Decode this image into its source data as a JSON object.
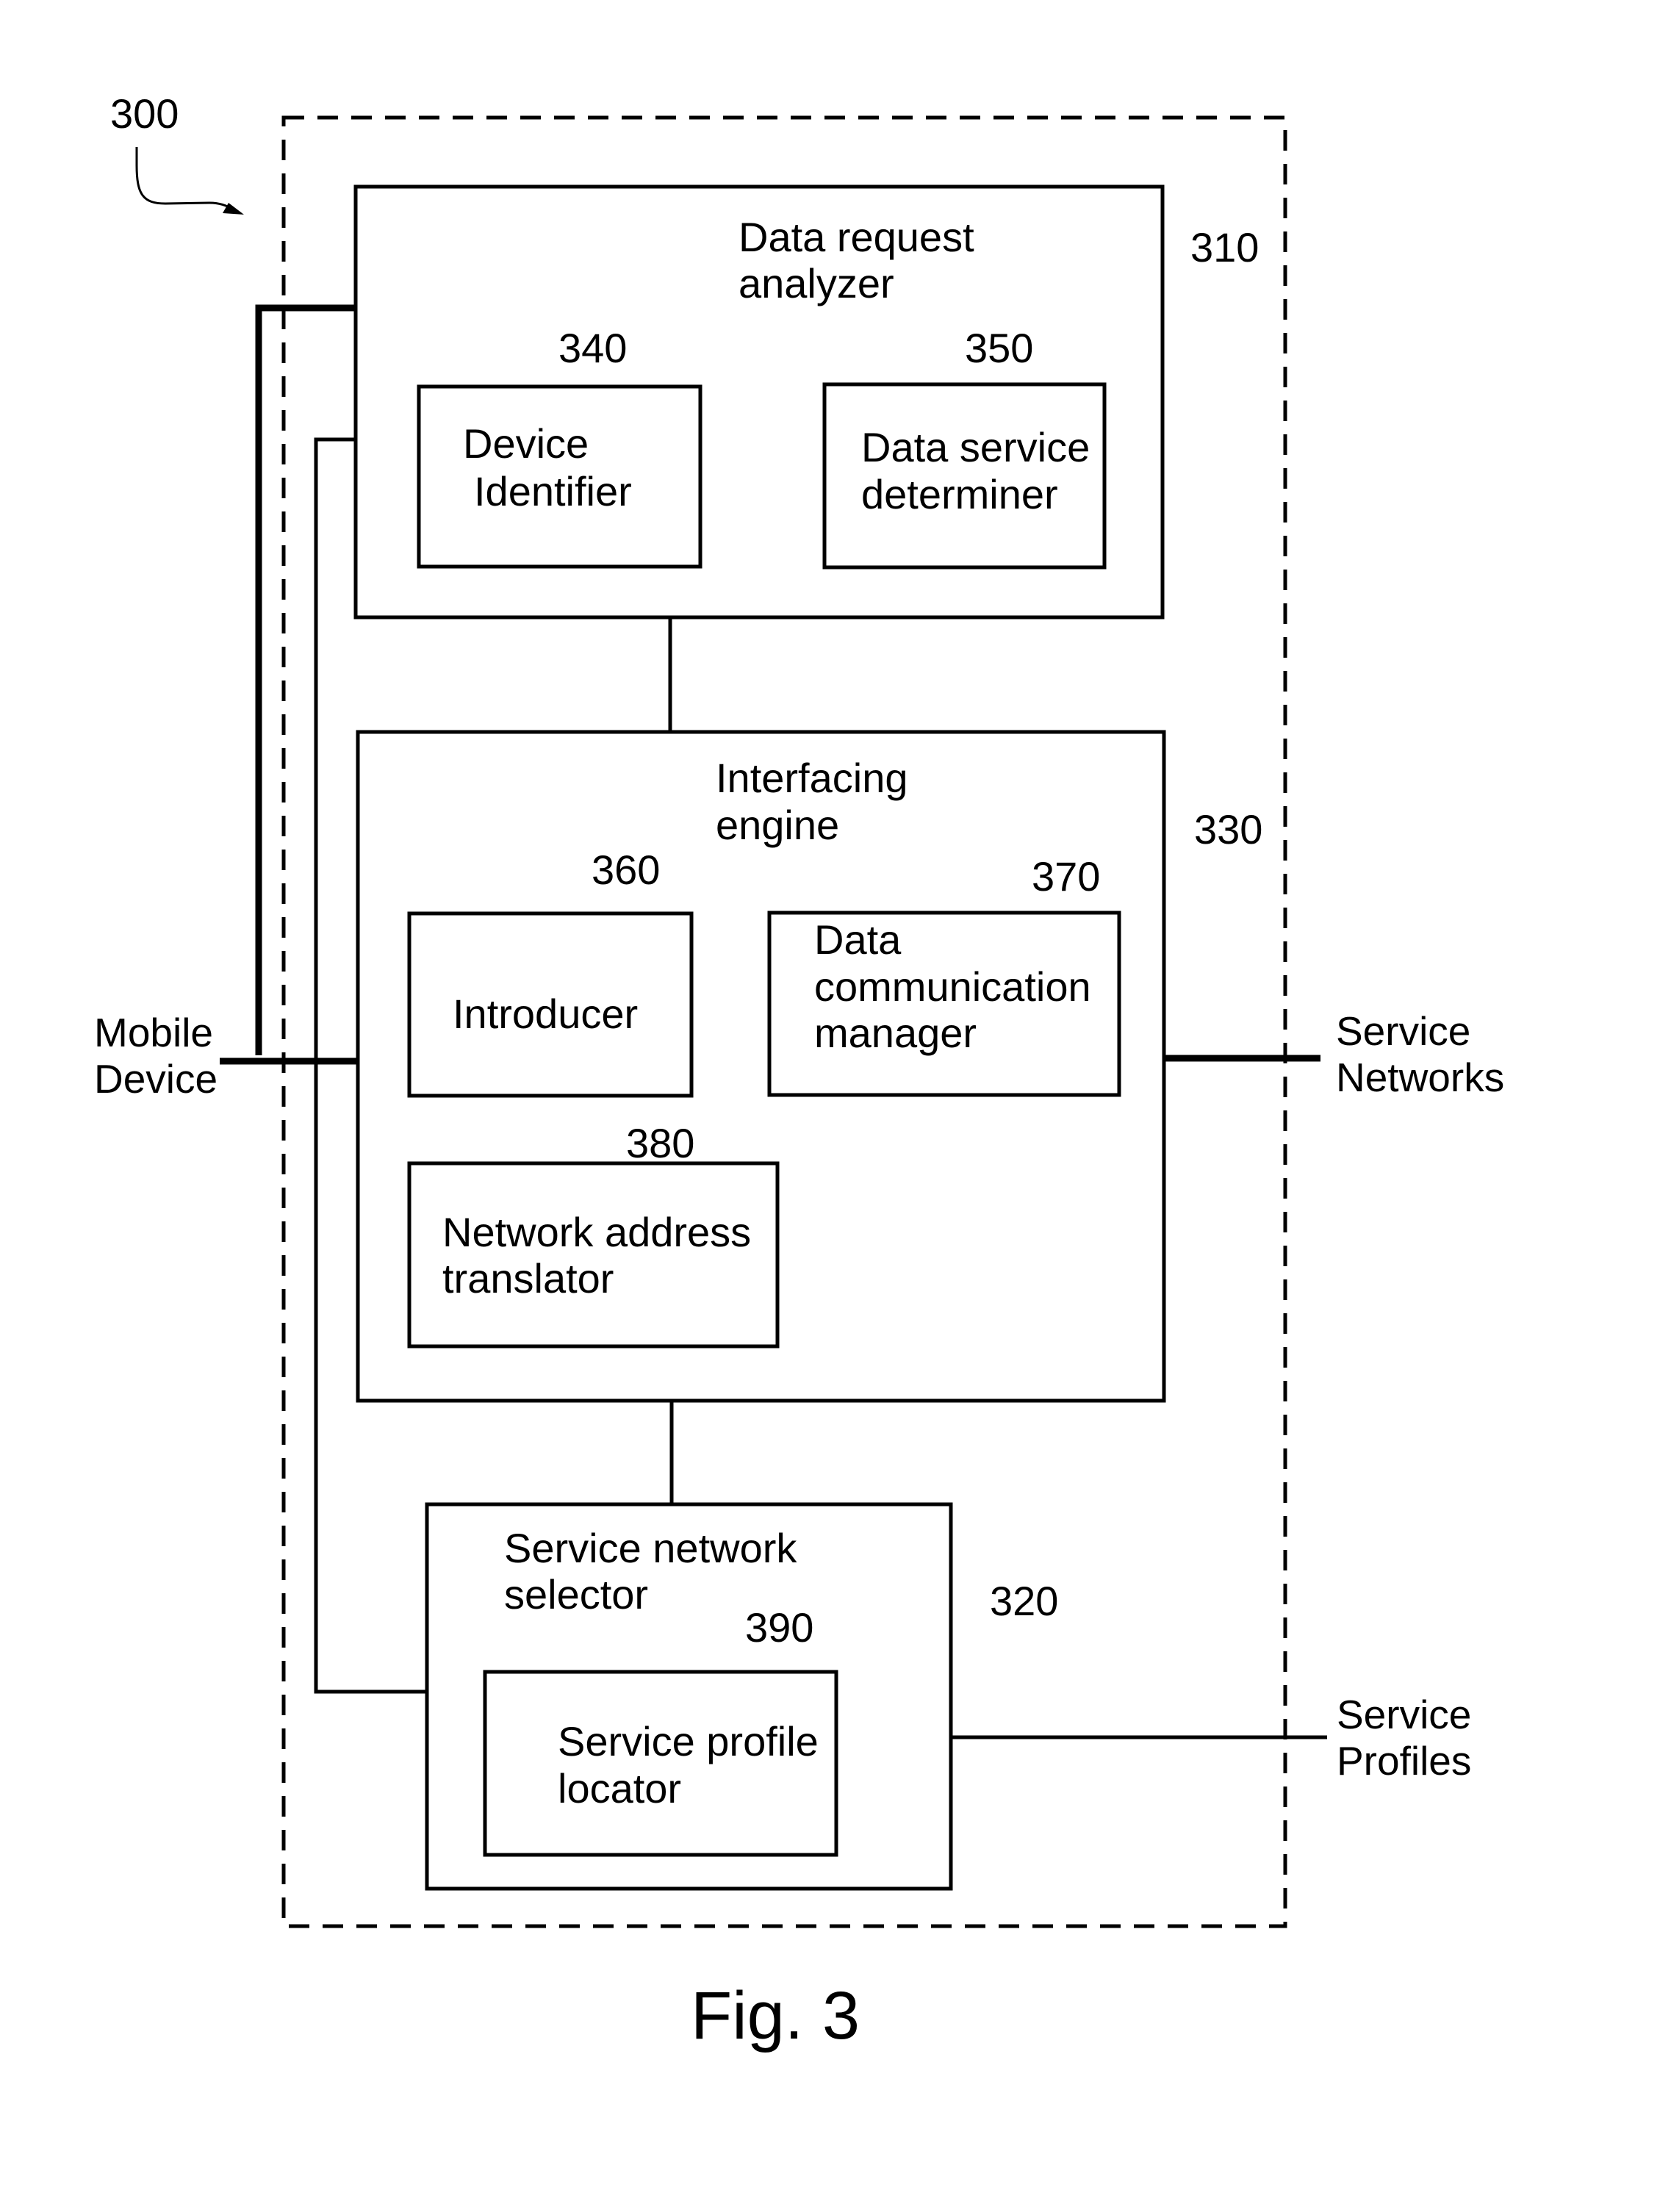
{
  "figure": {
    "caption": "Fig. 3",
    "system_ref": "300"
  },
  "blocks": {
    "data_request_analyzer": {
      "ref": "310",
      "title_lines": [
        "Data request",
        "analyzer"
      ],
      "children": {
        "device_identifier": {
          "ref": "340",
          "lines": [
            "Device",
            "Identifier"
          ]
        },
        "data_service_determiner": {
          "ref": "350",
          "lines": [
            "Data service",
            "determiner"
          ]
        }
      }
    },
    "interfacing_engine": {
      "ref": "330",
      "title_lines": [
        "Interfacing",
        "engine"
      ],
      "children": {
        "introducer": {
          "ref": "360",
          "lines": [
            "Introducer"
          ]
        },
        "data_communication_manager": {
          "ref": "370",
          "lines": [
            "Data",
            "communication",
            "manager"
          ]
        },
        "network_address_translator": {
          "ref": "380",
          "lines": [
            "Network address",
            "translator"
          ]
        }
      }
    },
    "service_network_selector": {
      "ref": "320",
      "title_lines": [
        "Service network",
        "selector"
      ],
      "children": {
        "service_profile_locator": {
          "ref": "390",
          "lines": [
            "Service profile",
            "locator"
          ]
        }
      }
    }
  },
  "external": {
    "mobile_device": [
      "Mobile",
      "Device"
    ],
    "service_networks": [
      "Service",
      "Networks"
    ],
    "service_profiles": [
      "Service",
      "Profiles"
    ]
  },
  "colors": {
    "ink": "#000000",
    "paper": "#ffffff"
  }
}
